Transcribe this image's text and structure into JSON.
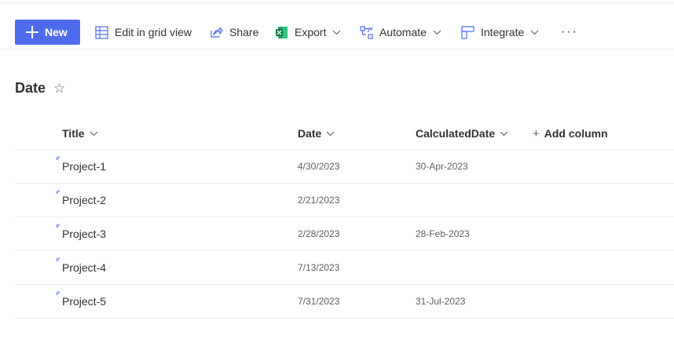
{
  "toolbar": {
    "new_label": "New",
    "edit_grid_label": "Edit in grid view",
    "share_label": "Share",
    "export_label": "Export",
    "automate_label": "Automate",
    "integrate_label": "Integrate",
    "more_label": "···"
  },
  "list": {
    "title": "Date",
    "star_glyph": "☆"
  },
  "columns": {
    "title": "Title",
    "date": "Date",
    "calculated": "CalculatedDate",
    "add": "Add column"
  },
  "rows": [
    {
      "title": "Project-1",
      "date": "4/30/2023",
      "calculated": "30-Apr-2023"
    },
    {
      "title": "Project-2",
      "date": "2/21/2023",
      "calculated": ""
    },
    {
      "title": "Project-3",
      "date": "2/28/2023",
      "calculated": "28-Feb-2023"
    },
    {
      "title": "Project-4",
      "date": "7/13/2023",
      "calculated": ""
    },
    {
      "title": "Project-5",
      "date": "7/31/2023",
      "calculated": "31-Jul-2023"
    }
  ],
  "colors": {
    "accent": "#4f6bed",
    "excel_green": "#107c41",
    "text": "#323130",
    "muted": "#605e5c",
    "divider": "#edebe9"
  }
}
